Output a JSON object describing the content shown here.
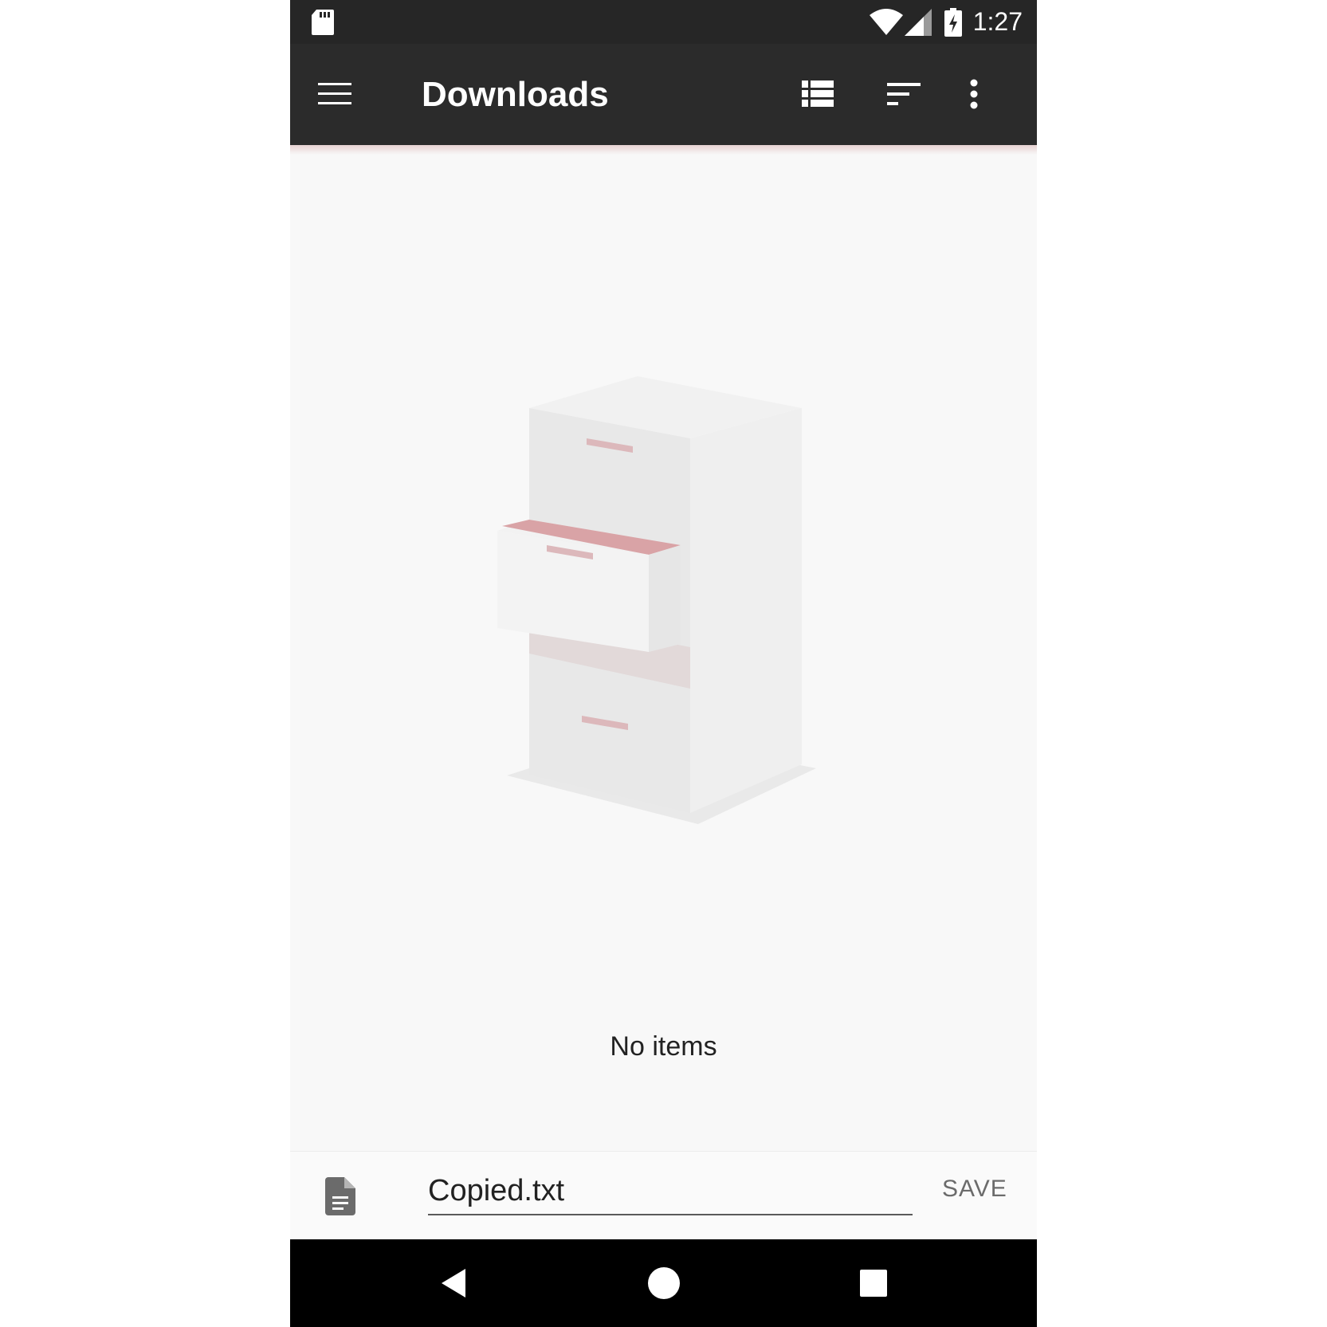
{
  "status_bar": {
    "time": "1:27",
    "icons": [
      "sd-card-icon",
      "wifi-icon",
      "signal-icon",
      "battery-charging-icon"
    ]
  },
  "toolbar": {
    "title": "Downloads",
    "icons": [
      "menu-icon",
      "list-view-icon",
      "sort-icon",
      "more-vert-icon"
    ]
  },
  "content": {
    "empty_message": "No items",
    "illustration": "filing-cabinet-illustration"
  },
  "save_bar": {
    "filename": "Copied.txt",
    "save_label": "SAVE",
    "icon": "document-icon"
  },
  "nav_bar": {
    "icons": [
      "back-icon",
      "home-icon",
      "recents-icon"
    ]
  },
  "colors": {
    "toolbar_bg": "#2b2b2b",
    "status_bg": "#262626",
    "accent_pink": "#d9a3a6",
    "content_bg": "#f8f8f8"
  }
}
